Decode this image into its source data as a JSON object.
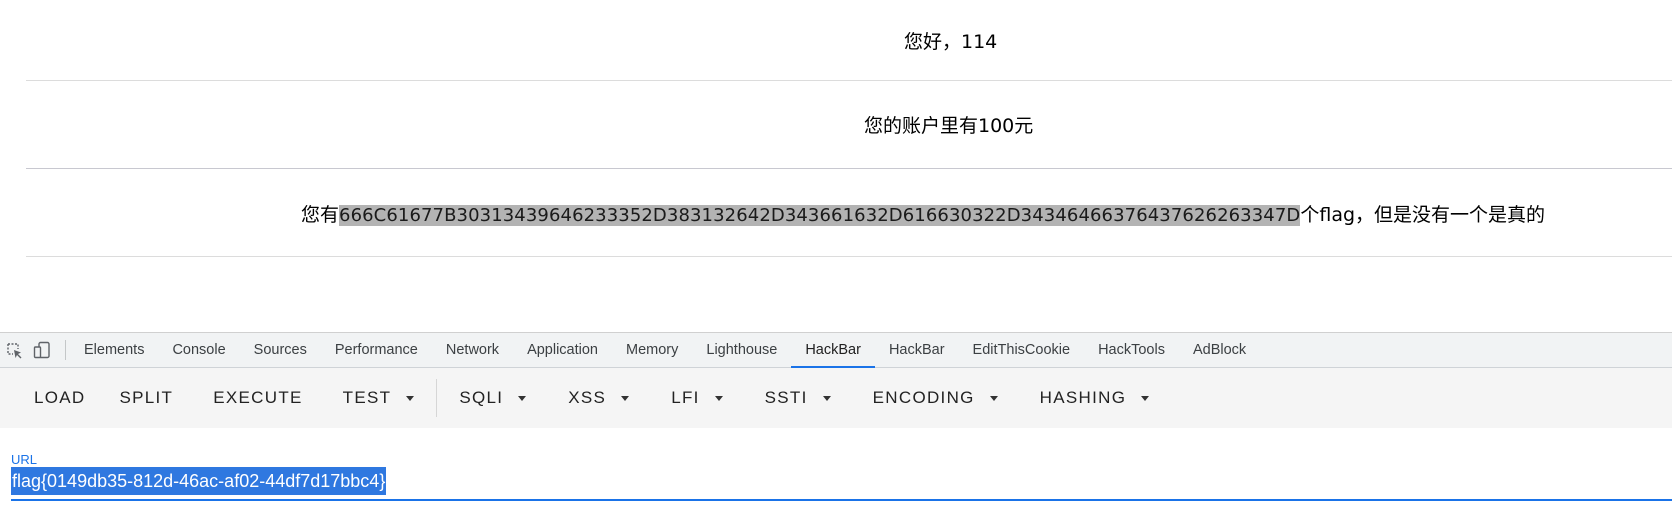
{
  "page": {
    "greeting": "您好，114",
    "balance": "您的账户里有100元",
    "flag_prefix": "您有",
    "flag_hex": "666C61677B30313439646233352D383132642D343661632D616630322D34346466376437626263347D",
    "flag_suffix": "个flag，但是没有一个是真的"
  },
  "devtools": {
    "icons": [
      "inspect-icon",
      "device-toggle-icon"
    ],
    "tabs": [
      {
        "label": "Elements"
      },
      {
        "label": "Console"
      },
      {
        "label": "Sources"
      },
      {
        "label": "Performance"
      },
      {
        "label": "Network"
      },
      {
        "label": "Application"
      },
      {
        "label": "Memory"
      },
      {
        "label": "Lighthouse"
      },
      {
        "label": "HackBar",
        "active": true
      },
      {
        "label": "HackBar"
      },
      {
        "label": "EditThisCookie"
      },
      {
        "label": "HackTools"
      },
      {
        "label": "AdBlock"
      }
    ],
    "active_tab_color": "#1a73e8"
  },
  "hackbar": {
    "buttons": [
      {
        "label": "LOAD"
      },
      {
        "label": "SPLIT"
      },
      {
        "label": "EXECUTE"
      },
      {
        "label": "TEST",
        "dropdown": true
      }
    ],
    "dropdowns": [
      {
        "label": "SQLI"
      },
      {
        "label": "XSS"
      },
      {
        "label": "LFI"
      },
      {
        "label": "SSTI"
      },
      {
        "label": "ENCODING"
      },
      {
        "label": "HASHING"
      }
    ],
    "url_label": "URL",
    "url_value": "flag{0149db35-812d-46ac-af02-44df7d17bbc4}",
    "accent_color": "#1a73e8",
    "selection_color": "#2f78e0"
  }
}
